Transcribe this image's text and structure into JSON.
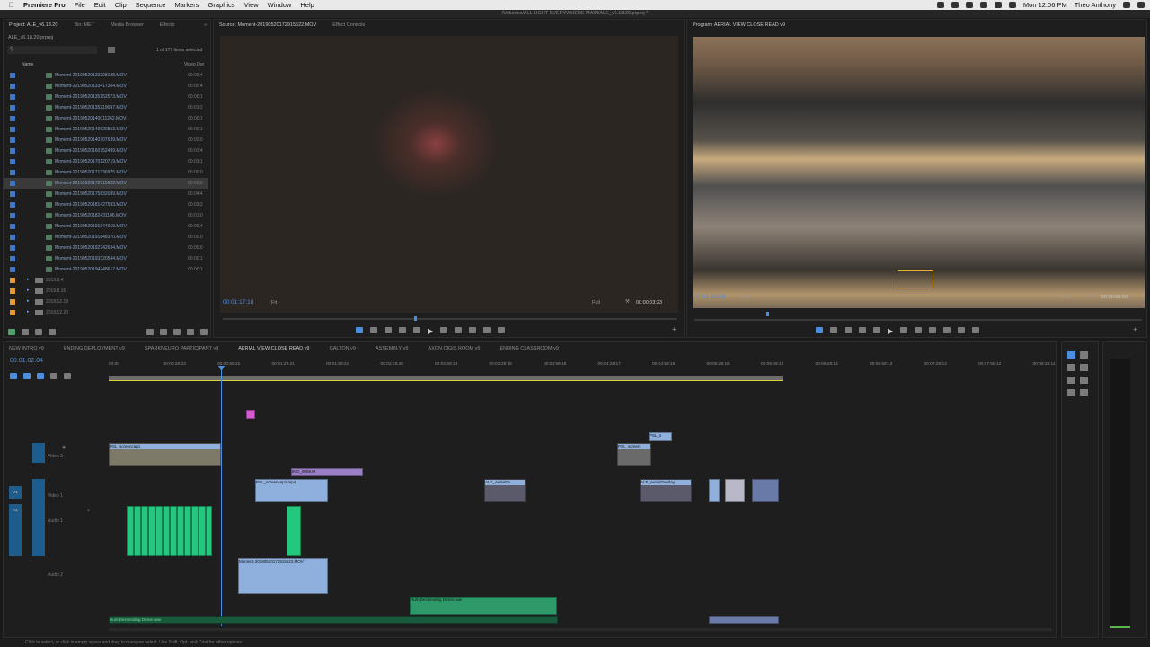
{
  "menubar": {
    "app_name": "Premiere Pro",
    "items": [
      "File",
      "Edit",
      "Clip",
      "Sequence",
      "Markers",
      "Graphics",
      "View",
      "Window",
      "Help"
    ],
    "clock": "Mon 12:06 PM",
    "user": "Theo Anthony"
  },
  "window_path": "/Volumes/ALL LIGHT EVERYWHERE MAIN/ALE_v6.18.20.prproj *",
  "project": {
    "tabs": [
      "Project: ALE_v6.18.20",
      "Bin: MET",
      "Media Browser",
      "Effects"
    ],
    "file_name": "ALE_v6.18.20.prproj",
    "selected_count": "1 of 177 items selected",
    "col_name": "Name",
    "col_duration": "Video Dur",
    "files": [
      {
        "name": "Moment-20190520133208128.MOV",
        "dur": "00:00:4"
      },
      {
        "name": "Moment-20190520133417364.MOV",
        "dur": "00:00:4"
      },
      {
        "name": "Moment-20190520135152573.MOV",
        "dur": "00:00:1"
      },
      {
        "name": "Moment-20190520135219097.MOV",
        "dur": "00:01:2"
      },
      {
        "name": "Moment-20190520140011262.MOV",
        "dur": "00:00:1"
      },
      {
        "name": "Moment-20190520140620853.MOV",
        "dur": "00:00:1"
      },
      {
        "name": "Moment-20190520140707639.MOV",
        "dur": "00:02:0"
      },
      {
        "name": "Moment-20190520160752499.MOV",
        "dur": "00:01:4"
      },
      {
        "name": "Moment-20190520170120719.MOV",
        "dur": "00:03:1"
      },
      {
        "name": "Moment-20190520171336975.MOV",
        "dur": "00:00:0"
      },
      {
        "name": "Moment-20190520172915622.MOV",
        "dur": "00:00:0",
        "selected": true
      },
      {
        "name": "Moment-20190520175832089.MOV",
        "dur": "00:04:4"
      },
      {
        "name": "Moment-20190520181427593.MOV",
        "dur": "00:03:2"
      },
      {
        "name": "Moment-20190520182431106.MOV",
        "dur": "00:01:0"
      },
      {
        "name": "Moment-20190520191344919.MOV",
        "dur": "00:00:4"
      },
      {
        "name": "Moment-20190520191848370.MOV",
        "dur": "00:00:0"
      },
      {
        "name": "Moment-20190520192742634.MOV",
        "dur": "00:00:0"
      },
      {
        "name": "Moment-20190520193320544.MOV",
        "dur": "00:00:1"
      },
      {
        "name": "Moment-20190520194248617.MOV",
        "dur": "00:00:1"
      }
    ],
    "bins": [
      "2019.6.4",
      "2019.8.16",
      "2019.12.19",
      "2019.12.20"
    ]
  },
  "source": {
    "tabs": [
      "Source: Moment-20190520172915622.MOV",
      "Effect Controls"
    ],
    "timecode": "00:01:17:18",
    "fit": "Fit",
    "full": "Full",
    "duration": "00:00:03:23"
  },
  "program": {
    "title": "Program: AERIAL VIEW CLOSE READ v9",
    "timecode": "00:01:02:04",
    "fit": "Fit",
    "full": "Full",
    "duration": "00:06:08:00"
  },
  "timeline": {
    "tabs": [
      "NEW INTRO v9",
      "ENDING DEPLOYMENT v9",
      "SPARKNEURO PARTICIPANT v9",
      "AERIAL VIEW CLOSE READ v9",
      "GALTON v9",
      "ASSEMBLY v9",
      "AXON CIGIS ROOM v9",
      "ENDING CLASSROOM v9"
    ],
    "active_tab": "AERIAL VIEW CLOSE READ v9",
    "timecode": "00:01:02:04",
    "ruler": [
      "00:00",
      "00:00:29:23",
      "00:00:59:22",
      "00:01:29:21",
      "00:01:59:21",
      "00:02:29:20",
      "00:02:59:19",
      "00:03:29:18",
      "00:03:59:18",
      "00:04:29:17",
      "00:04:59:16",
      "00:05:29:16",
      "00:05:59:15",
      "00:06:29:14",
      "00:06:59:13",
      "00:07:29:13",
      "00:07:59:12",
      "00:08:29:11"
    ],
    "track_labels": {
      "video3": "Video 3",
      "video1": "Video 1",
      "audio1": "Audio 1",
      "audio2": "Audio 2",
      "v1": "V1",
      "a1": "A1"
    },
    "clips": {
      "v3a": "PSL_screencap1",
      "v3b": "PSL_screenc",
      "v2a": "PSL",
      "v2b": "Copy 1",
      "v2c": "IMG_9059.M",
      "v1a": "PSL_screencap1.mp4",
      "v1b": "ALE_AerialOv",
      "v1c": "ALE_AerialOverlay",
      "v3c": "PSL_screen",
      "v4": "PSL_s",
      "a2": "Moment-20190520172915622.MOV",
      "a3": "Hum.Descending Drone.wav",
      "a4": "Hum.Descending Drone.wav"
    }
  },
  "status_text": "Click to select, or click in empty space and drag to marquee select. Use Shift, Opt, and Cmd for other options.",
  "colors": {
    "accent": "#4b8ee0",
    "menubar": "#e9e9e9",
    "video_clip": "#8fb0dc",
    "audio_clip": "#23c87e",
    "label_pink": "#d65bd3",
    "bin_orange": "#e89a32"
  }
}
